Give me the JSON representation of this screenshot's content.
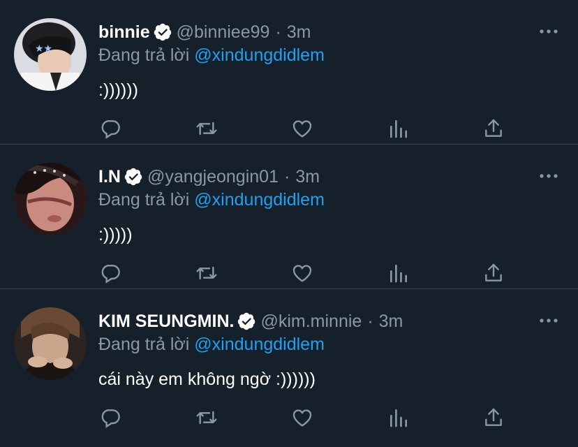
{
  "reply_prefix": "Đang trả lời",
  "colors": {
    "background": "#15202b",
    "secondary_text": "#8899a6",
    "mention": "#1da1f2",
    "divider": "#38444d"
  },
  "tweets": [
    {
      "name": "binnie",
      "handle": "@binniee99",
      "separator": "·",
      "time": "3m",
      "reply_to": "@xindungdidlem",
      "text": ":))))))",
      "verified": true
    },
    {
      "name": "I.N",
      "handle": "@yangjeongin01",
      "separator": "·",
      "time": "3m",
      "reply_to": "@xindungdidlem",
      "text": ":)))))",
      "verified": true
    },
    {
      "name": "KIM SEUNGMIN.",
      "handle": "@kim.minnie",
      "separator": "·",
      "time": "3m",
      "reply_to": "@xindungdidlem",
      "text": "cái này em không ngờ :))))))",
      "verified": true
    }
  ],
  "action_icons": [
    "reply-icon",
    "retweet-icon",
    "like-icon",
    "analytics-icon",
    "share-icon"
  ]
}
